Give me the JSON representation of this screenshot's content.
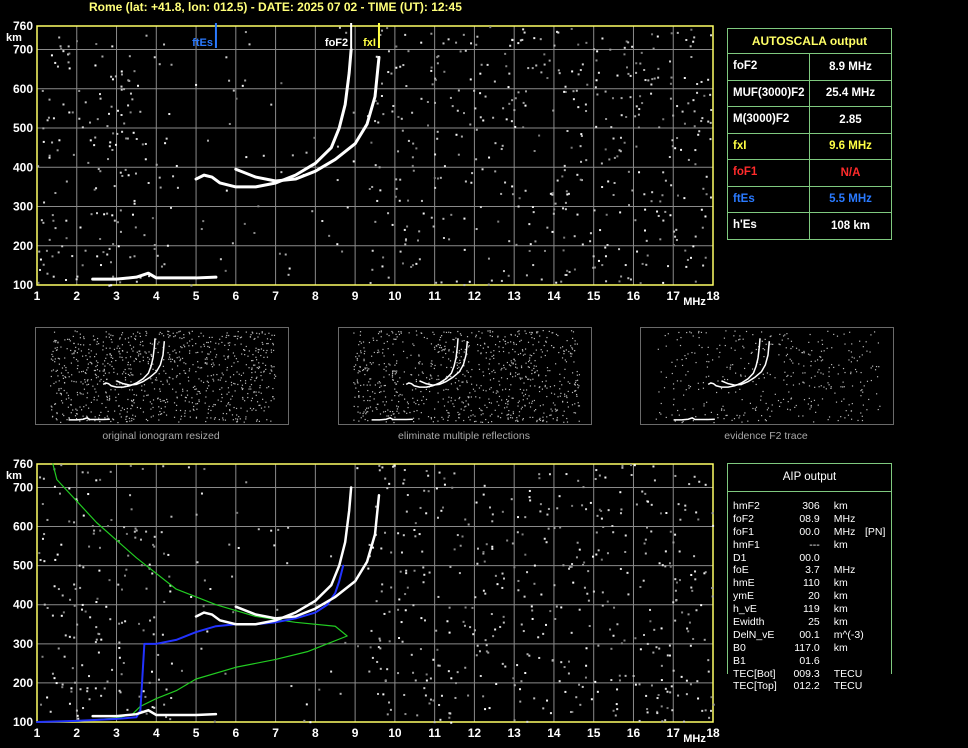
{
  "header": "Rome (lat: +41.8, lon: 012.5) - DATE: 2025 07 02 - TIME (UT): 12:45",
  "colors": {
    "grid": "#8a8a8a",
    "axis": "#ffff66",
    "panel_border": "#7fc97f",
    "ftes": "#2a7aff",
    "fxi": "#ffff44",
    "fof1": "#ff2b2b",
    "profile": "#22cc22",
    "trace_fit": "#2233ff"
  },
  "chart_data": [
    {
      "type": "scatter",
      "title": "",
      "xlabel": "MHz",
      "ylabel": "km",
      "xlim": [
        1,
        18
      ],
      "ylim": [
        100,
        760
      ],
      "xticks": [
        1,
        2,
        3,
        4,
        5,
        6,
        7,
        8,
        9,
        10,
        11,
        12,
        13,
        14,
        15,
        16,
        17,
        18
      ],
      "yticks": [
        100,
        200,
        300,
        400,
        500,
        600,
        700,
        760
      ],
      "grid": true,
      "markers": [
        {
          "label": "ftEs",
          "x": 5.5,
          "color": "ftes"
        },
        {
          "label": "foF2",
          "x": 8.9,
          "color": "white"
        },
        {
          "label": "fxI",
          "x": 9.6,
          "color": "fxi"
        }
      ],
      "series": [
        {
          "values": [
            [
              5.0,
              370
            ],
            [
              5.2,
              380
            ],
            [
              5.4,
              375
            ],
            [
              5.6,
              360
            ],
            [
              6.0,
              350
            ],
            [
              6.5,
              350
            ],
            [
              7.0,
              360
            ],
            [
              7.5,
              380
            ],
            [
              8.0,
              410
            ],
            [
              8.4,
              450
            ],
            [
              8.6,
              500
            ],
            [
              8.75,
              560
            ],
            [
              8.85,
              640
            ],
            [
              8.9,
              700
            ]
          ]
        },
        {
          "values": [
            [
              6.0,
              395
            ],
            [
              6.5,
              375
            ],
            [
              7.0,
              365
            ],
            [
              7.5,
              370
            ],
            [
              8.0,
              390
            ],
            [
              8.5,
              420
            ],
            [
              9.0,
              460
            ],
            [
              9.3,
              510
            ],
            [
              9.5,
              580
            ],
            [
              9.6,
              680
            ]
          ]
        },
        {
          "values": [
            [
              2.4,
              115
            ],
            [
              3.0,
              115
            ],
            [
              3.5,
              120
            ],
            [
              3.8,
              130
            ],
            [
              4.0,
              118
            ],
            [
              5.0,
              118
            ],
            [
              5.5,
              120
            ]
          ]
        }
      ]
    },
    {
      "type": "line",
      "title": "",
      "xlabel": "MHz",
      "ylabel": "km",
      "xlim": [
        1,
        18
      ],
      "ylim": [
        100,
        760
      ],
      "xticks": [
        1,
        2,
        3,
        4,
        5,
        6,
        7,
        8,
        9,
        10,
        11,
        12,
        13,
        14,
        15,
        16,
        17,
        18
      ],
      "yticks": [
        100,
        200,
        300,
        400,
        500,
        600,
        700,
        760
      ],
      "grid": true,
      "series": [
        {
          "values": [
            [
              1.0,
              100
            ],
            [
              2.0,
              102
            ],
            [
              3.0,
              110
            ],
            [
              3.4,
              120
            ],
            [
              3.6,
              140
            ],
            [
              4.0,
              160
            ],
            [
              4.5,
              180
            ],
            [
              5.0,
              210
            ],
            [
              6.0,
              240
            ],
            [
              7.0,
              260
            ],
            [
              7.8,
              280
            ],
            [
              8.3,
              300
            ],
            [
              8.8,
              320
            ],
            [
              8.5,
              345
            ],
            [
              7.5,
              355
            ],
            [
              6.5,
              370
            ],
            [
              5.5,
              400
            ],
            [
              4.5,
              440
            ],
            [
              3.5,
              520
            ],
            [
              2.5,
              610
            ],
            [
              1.5,
              720
            ],
            [
              1.4,
              760
            ]
          ]
        },
        {
          "values": [
            [
              1.0,
              100
            ],
            [
              2.0,
              103
            ],
            [
              3.0,
              108
            ],
            [
              3.5,
              112
            ],
            [
              3.6,
              130
            ],
            [
              3.7,
              300
            ],
            [
              4.0,
              300
            ],
            [
              4.5,
              310
            ],
            [
              5.0,
              330
            ],
            [
              5.5,
              345
            ],
            [
              6.0,
              350
            ],
            [
              6.5,
              350
            ],
            [
              7.0,
              355
            ],
            [
              7.5,
              365
            ],
            [
              8.0,
              380
            ],
            [
              8.3,
              400
            ],
            [
              8.5,
              430
            ],
            [
              8.6,
              460
            ],
            [
              8.7,
              500
            ]
          ]
        }
      ]
    }
  ],
  "autoscala": {
    "title": "AUTOSCALA output",
    "rows": [
      {
        "key": "foF2",
        "value": "8.9 MHz",
        "color": "#ffffff"
      },
      {
        "key": "MUF(3000)F2",
        "value": "25.4 MHz",
        "color": "#ffffff"
      },
      {
        "key": "M(3000)F2",
        "value": "2.85",
        "color": "#ffffff"
      },
      {
        "key": "fxI",
        "value": "9.6 MHz",
        "color": "#ffff44"
      },
      {
        "key": "foF1",
        "value": "N/A",
        "color": "#ff2b2b"
      },
      {
        "key": "ftEs",
        "value": "5.5 MHz",
        "color": "#2a7aff"
      },
      {
        "key": "h'Es",
        "value": "108     km",
        "color": "#ffffff"
      }
    ]
  },
  "thumbnails": [
    {
      "caption": "original ionogram resized"
    },
    {
      "caption": "eliminate multiple reflections"
    },
    {
      "caption": "evidence F2 trace"
    }
  ],
  "aip": {
    "title": "AIP output",
    "rows": [
      {
        "name": "hmF2",
        "value": "306",
        "unit": "km",
        "flag": ""
      },
      {
        "name": "foF2",
        "value": "08.9",
        "unit": "MHz",
        "flag": ""
      },
      {
        "name": "foF1",
        "value": "00.0",
        "unit": "MHz",
        "flag": "[PN]"
      },
      {
        "name": "hmF1",
        "value": "---",
        "unit": "km",
        "flag": ""
      },
      {
        "name": "D1",
        "value": "00.0",
        "unit": "",
        "flag": ""
      },
      {
        "name": "foE",
        "value": "3.7",
        "unit": "MHz",
        "flag": ""
      },
      {
        "name": "hmE",
        "value": "110",
        "unit": "km",
        "flag": ""
      },
      {
        "name": "ymE",
        "value": "20",
        "unit": "km",
        "flag": ""
      },
      {
        "name": "h_vE",
        "value": "119",
        "unit": "km",
        "flag": ""
      },
      {
        "name": "Ewidth",
        "value": "25",
        "unit": "km",
        "flag": ""
      },
      {
        "name": "DelN_vE",
        "value": "00.1",
        "unit": "m^(-3)",
        "flag": ""
      },
      {
        "name": "B0",
        "value": "117.0",
        "unit": "km",
        "flag": ""
      },
      {
        "name": "B1",
        "value": "01.6",
        "unit": "",
        "flag": ""
      },
      {
        "name": "TEC[Bot]",
        "value": "009.3",
        "unit": "TECU",
        "flag": ""
      },
      {
        "name": "TEC[Top]",
        "value": "012.2",
        "unit": "TECU",
        "flag": ""
      }
    ]
  }
}
